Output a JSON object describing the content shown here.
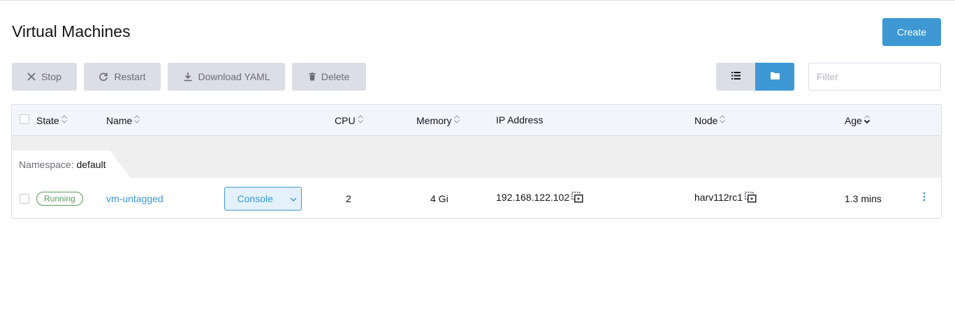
{
  "page": {
    "title": "Virtual Machines",
    "create_label": "Create"
  },
  "toolbar": {
    "stop_label": "Stop",
    "restart_label": "Restart",
    "download_label": "Download YAML",
    "delete_label": "Delete"
  },
  "filter": {
    "placeholder": "Filter",
    "value": ""
  },
  "table": {
    "columns": {
      "state": "State",
      "name": "Name",
      "cpu": "CPU",
      "memory": "Memory",
      "ip": "IP Address",
      "node": "Node",
      "age": "Age"
    },
    "group": {
      "prefix": "Namespace:",
      "name": "default"
    },
    "rows": [
      {
        "state": "Running",
        "name": "vm-untagged",
        "console_label": "Console",
        "cpu": "2",
        "memory": "4 Gi",
        "ip": "192.168.122.102",
        "node": "harv112rc1",
        "age": "1.3 mins"
      }
    ]
  },
  "icons": {
    "stop": "close-icon",
    "restart": "refresh-icon",
    "download": "download-icon",
    "delete": "trash-icon",
    "list_view": "list-icon",
    "folder_view": "folder-icon",
    "copy": "copy-icon",
    "actions": "kebab-menu-icon"
  },
  "colors": {
    "accent": "#3d98d3",
    "success": "#5d995d",
    "muted_button": "#dcdee7"
  }
}
